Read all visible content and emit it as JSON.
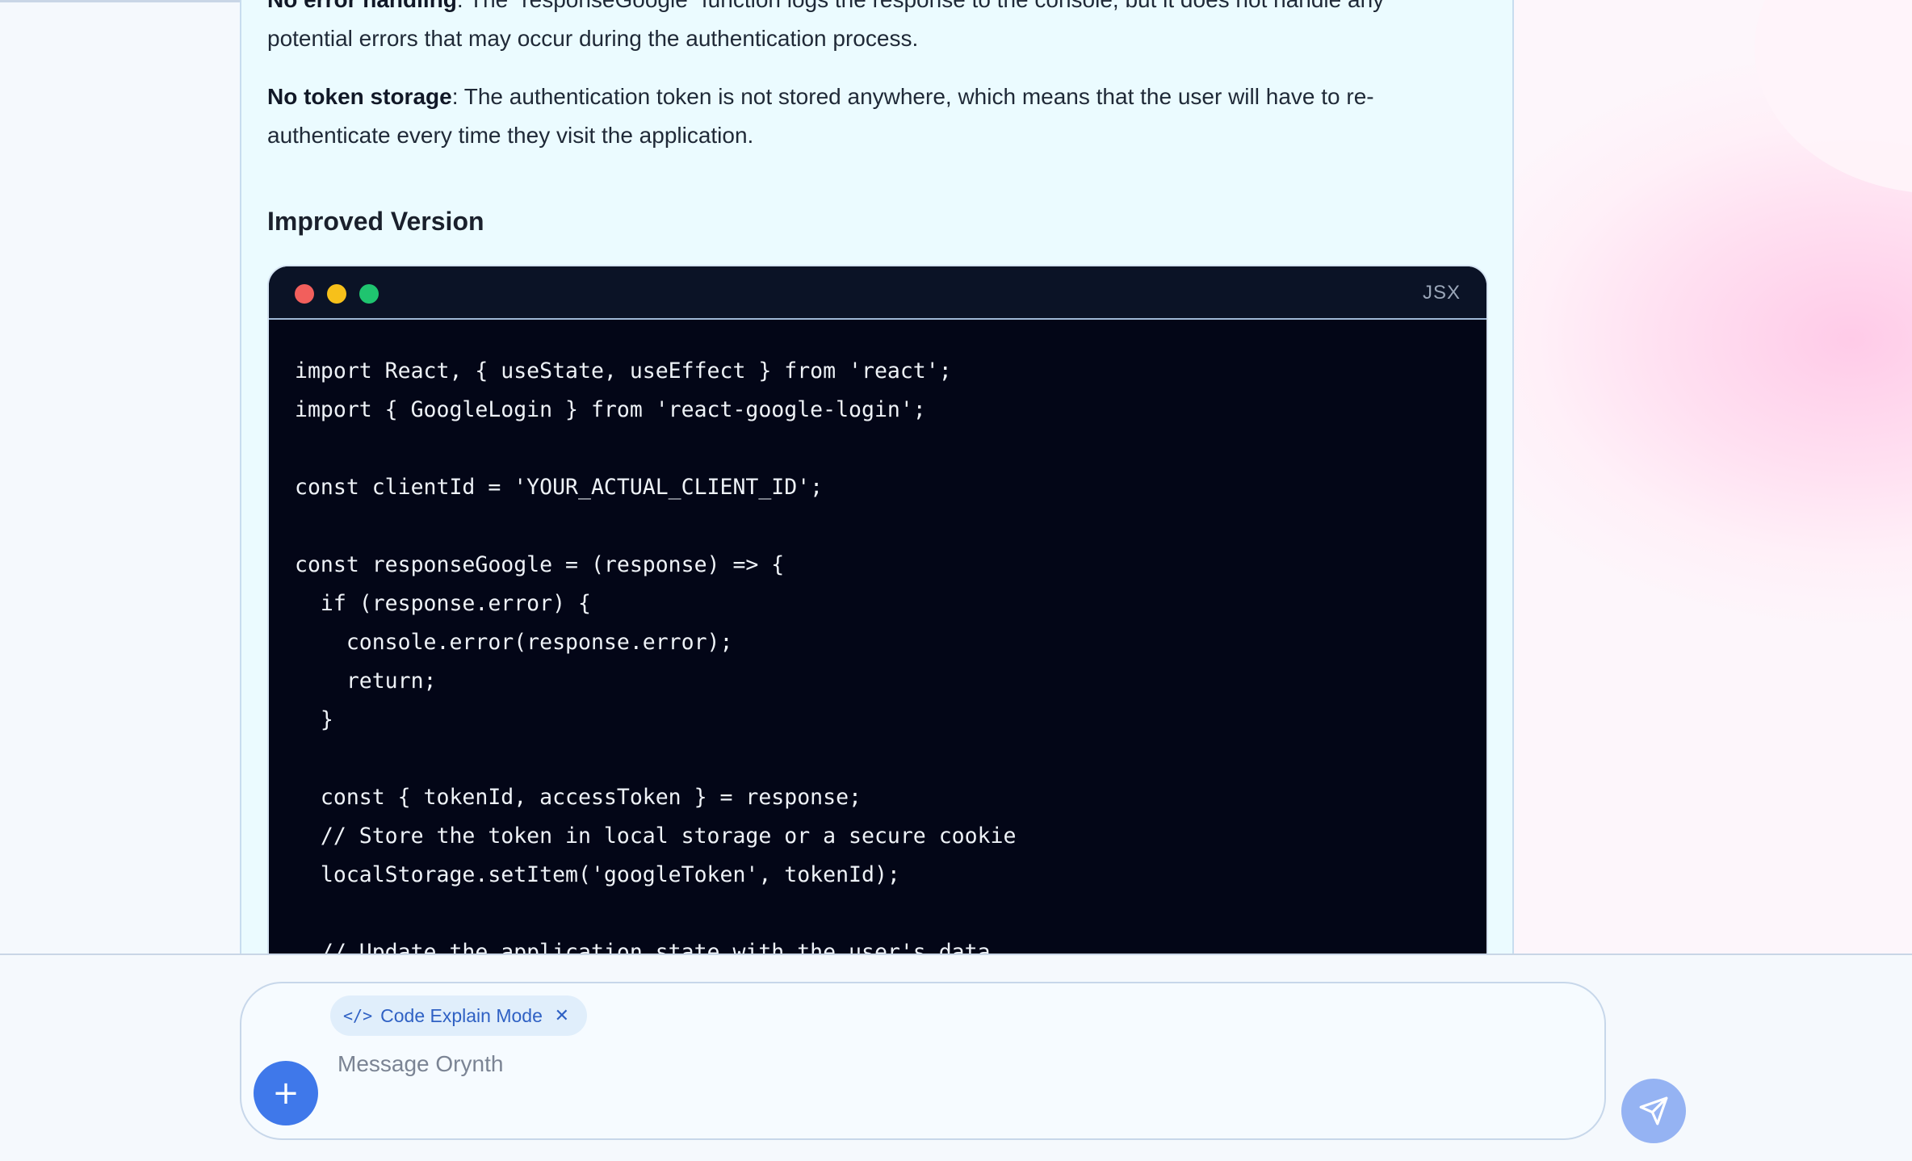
{
  "content": {
    "para_error": {
      "label": "No error handling",
      "text": ": The `responseGoogle` function logs the response to the console, but it does not handle any potential errors that may occur during the authentication process."
    },
    "para_token": {
      "label": "No token storage",
      "text": ": The authentication token is not stored anywhere, which means that the user will have to re-authenticate every time they visit the application."
    },
    "heading": "Improved Version"
  },
  "code_block": {
    "language": "JSX",
    "code": "import React, { useState, useEffect } from 'react';\nimport { GoogleLogin } from 'react-google-login';\n\nconst clientId = 'YOUR_ACTUAL_CLIENT_ID';\n\nconst responseGoogle = (response) => {\n  if (response.error) {\n    console.error(response.error);\n    return;\n  }\n\n  const { tokenId, accessToken } = response;\n  // Store the token in local storage or a secure cookie\n  localStorage.setItem('googleToken', tokenId);\n\n  // Update the application state with the user's data"
  },
  "composer": {
    "mode_chip": "Code Explain Mode",
    "placeholder": "Message Orynth",
    "value": ""
  },
  "icons": {
    "mode": "code-icon",
    "mode_close": "close-icon",
    "attach": "plus-icon",
    "send": "send-icon",
    "window_controls": [
      "red-dot",
      "yellow-dot",
      "green-dot"
    ]
  },
  "colors": {
    "accent": "#3f78ea",
    "send_disabled": "#95b3f3",
    "code_bg": "#030617",
    "panel_bg": "#ebfbff"
  }
}
